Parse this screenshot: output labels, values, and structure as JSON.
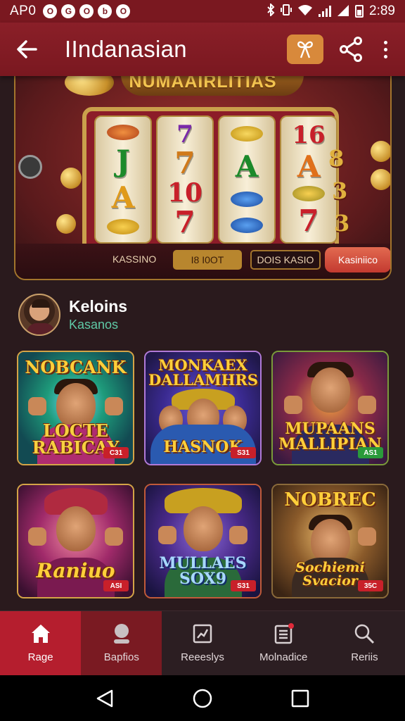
{
  "status_bar": {
    "carrier": "AP0",
    "notif_glyphs": [
      "O",
      "G",
      "O",
      "b",
      "O"
    ],
    "icons": [
      "bluetooth-icon",
      "vibrate-icon",
      "wifi-icon",
      "signal-icon",
      "battery-icon"
    ],
    "time": "2:89"
  },
  "app_bar": {
    "title": "IIndanasian",
    "back_icon": "arrow-left-icon",
    "gift_icon": "gift-icon",
    "share_icon": "share-icon",
    "more_icon": "more-vertical-icon"
  },
  "banner": {
    "title": "NUMAAIRLITIAS",
    "reels": [
      [
        "",
        "J",
        "A",
        ""
      ],
      [
        "7",
        "7",
        "10",
        "7"
      ],
      [
        "",
        "A",
        "",
        ""
      ],
      [
        "16",
        "A",
        "",
        "7"
      ]
    ],
    "side_right": [
      "8",
      "3",
      "3"
    ],
    "bar": {
      "label_1": "KASSINO",
      "label_2": "I8 I0OT",
      "label_3": "DOIS KASIO",
      "label_4": "Kasiniico"
    }
  },
  "profile": {
    "name": "Keloins",
    "subtitle": "Kasanos"
  },
  "games": [
    {
      "title_top": "NOBCANK",
      "title_bottom": "LOCTE RABICAY",
      "badge": "C31"
    },
    {
      "title_top": "MONKAEX DALLAMHRS",
      "title_bottom": "HASNOK",
      "badge": "S31"
    },
    {
      "title_top": "",
      "title_bottom": "MUPAANS MALLIPIAN",
      "badge": "AS1"
    },
    {
      "title_top": "",
      "title_bottom": "Raniuo",
      "badge": "ASI"
    },
    {
      "title_top": "",
      "title_bottom": "MULLAES SOX9",
      "badge": "S31"
    },
    {
      "title_top": "NOBREC",
      "title_bottom": "Sochiemi Svacior",
      "badge": "35C"
    }
  ],
  "bottom_nav": [
    {
      "label": "Rage",
      "icon": "home-icon"
    },
    {
      "label": "Bapfios",
      "icon": "profile-icon"
    },
    {
      "label": "Reeeslys",
      "icon": "chart-icon"
    },
    {
      "label": "Molnadice",
      "icon": "document-icon"
    },
    {
      "label": "Reriis",
      "icon": "search-icon"
    }
  ],
  "system_nav": [
    "back-triangle-icon",
    "home-circle-icon",
    "recents-square-icon"
  ],
  "colors": {
    "app_bar": "#7a1820",
    "accent_active": "#b51e2e",
    "gift_button": "#d8893b",
    "gold": "#d4a447",
    "subtitle_teal": "#5fc9a6"
  }
}
